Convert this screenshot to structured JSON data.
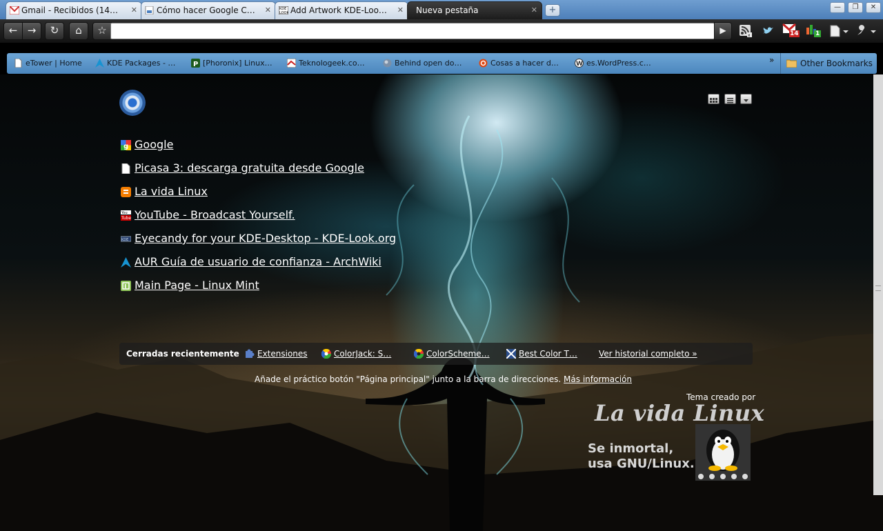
{
  "tabs": [
    {
      "title": "Gmail - Recibidos (14…",
      "icon": "gmail-icon"
    },
    {
      "title": "Cómo hacer Google C…",
      "icon": "page-icon"
    },
    {
      "title": "Add Artwork KDE-Loo…",
      "icon": "kde-look-icon"
    },
    {
      "title": "Nueva pestaña",
      "icon": "none",
      "active": true
    }
  ],
  "toolbar": {
    "address": "",
    "extensions": [
      "rss-icon",
      "twitter-bird-icon",
      "gmail-checker-icon",
      "counter-icon",
      "page-icon",
      "wrench-icon"
    ],
    "gmail_count": "14",
    "counter_badge": "1"
  },
  "bookmarks": {
    "items": [
      {
        "label": "eTower | Home",
        "icon": "page-icon"
      },
      {
        "label": "KDE Packages - …",
        "icon": "arch-icon"
      },
      {
        "label": "[Phoronix] Linux…",
        "icon": "phoronix-icon"
      },
      {
        "label": "Teknologeek.co…",
        "icon": "teknologeek-icon"
      },
      {
        "label": "Behind open do…",
        "icon": "globe-icon"
      },
      {
        "label": "Cosas a hacer d…",
        "icon": "ubuntu-icon"
      },
      {
        "label": "es.WordPress.c…",
        "icon": "wordpress-icon"
      }
    ],
    "overflow": "»",
    "other": "Other Bookmarks"
  },
  "most_visited": [
    {
      "title": "Google",
      "icon": "google-icon"
    },
    {
      "title": "Picasa 3: descarga gratuita desde Google",
      "icon": "page-icon"
    },
    {
      "title": "La vida Linux",
      "icon": "blogger-icon"
    },
    {
      "title": "YouTube - Broadcast Yourself.",
      "icon": "youtube-icon"
    },
    {
      "title": "Eyecandy for your KDE-Desktop - KDE-Look.org",
      "icon": "kde-look-icon"
    },
    {
      "title": "AUR Guía de usuario de confianza - ArchWiki",
      "icon": "arch-icon"
    },
    {
      "title": "Main Page - Linux Mint",
      "icon": "mint-icon"
    }
  ],
  "recently_closed": {
    "title": "Cerradas recientemente",
    "items": [
      {
        "label": "Extensiones",
        "icon": "puzzle-icon"
      },
      {
        "label": "ColorJack: S…",
        "icon": "color-wheel-icon"
      },
      {
        "label": "ColorScheme…",
        "icon": "color-wheel-icon"
      },
      {
        "label": "Best Color T…",
        "icon": "pattern-icon"
      }
    ],
    "history_link": "Ver historial completo »"
  },
  "promo": {
    "text": "Añade el práctico botón \"Página principal\" junto a la barra de direcciones.",
    "link": "Más información"
  },
  "theme": {
    "attribution": "Tema creado por",
    "brand": "La vida Linux",
    "slogan_line1": "Se inmortal,",
    "slogan_line2": "usa GNU/Linux."
  }
}
